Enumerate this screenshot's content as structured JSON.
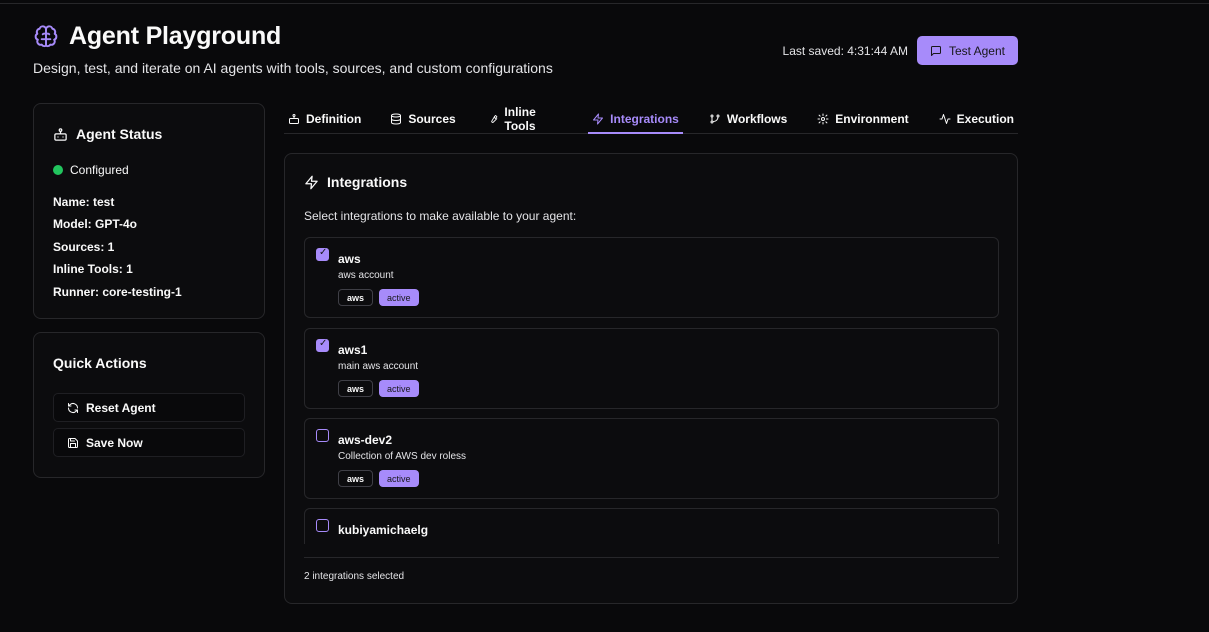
{
  "header": {
    "title": "Agent Playground",
    "subtitle": "Design, test, and iterate on AI agents with tools, sources, and custom configurations",
    "last_saved": "Last saved: 4:31:44 AM",
    "test_button": "Test Agent"
  },
  "status": {
    "title": "Agent Status",
    "state": "Configured",
    "name": "Name: test",
    "model": "Model: GPT-4o",
    "sources": "Sources: 1",
    "inline_tools": "Inline Tools: 1",
    "runner": "Runner: core-testing-1"
  },
  "actions": {
    "title": "Quick Actions",
    "reset": "Reset Agent",
    "save": "Save Now"
  },
  "tabs": [
    {
      "label": "Definition",
      "icon": "bot-icon"
    },
    {
      "label": "Sources",
      "icon": "database-icon"
    },
    {
      "label": "Inline Tools",
      "icon": "wrench-icon"
    },
    {
      "label": "Integrations",
      "icon": "bolt-icon",
      "active": true
    },
    {
      "label": "Workflows",
      "icon": "git-branch-icon"
    },
    {
      "label": "Environment",
      "icon": "gear-icon"
    },
    {
      "label": "Execution",
      "icon": "activity-icon"
    }
  ],
  "integrations": {
    "title": "Integrations",
    "description": "Select integrations to make available to your agent:",
    "items": [
      {
        "name": "aws",
        "description": "aws account",
        "type": "aws",
        "status": "active",
        "checked": true
      },
      {
        "name": "aws1",
        "description": "main aws account",
        "type": "aws",
        "status": "active",
        "checked": true
      },
      {
        "name": "aws-dev2",
        "description": "Collection of AWS dev roless",
        "type": "aws",
        "status": "active",
        "checked": false
      },
      {
        "name": "kubiyamichaelg",
        "description": "",
        "type": "",
        "status": "",
        "checked": false
      }
    ],
    "footer": "2 integrations selected"
  },
  "colors": {
    "accent": "#a78bfa",
    "status_green": "#22c55e",
    "background": "#09090b"
  }
}
